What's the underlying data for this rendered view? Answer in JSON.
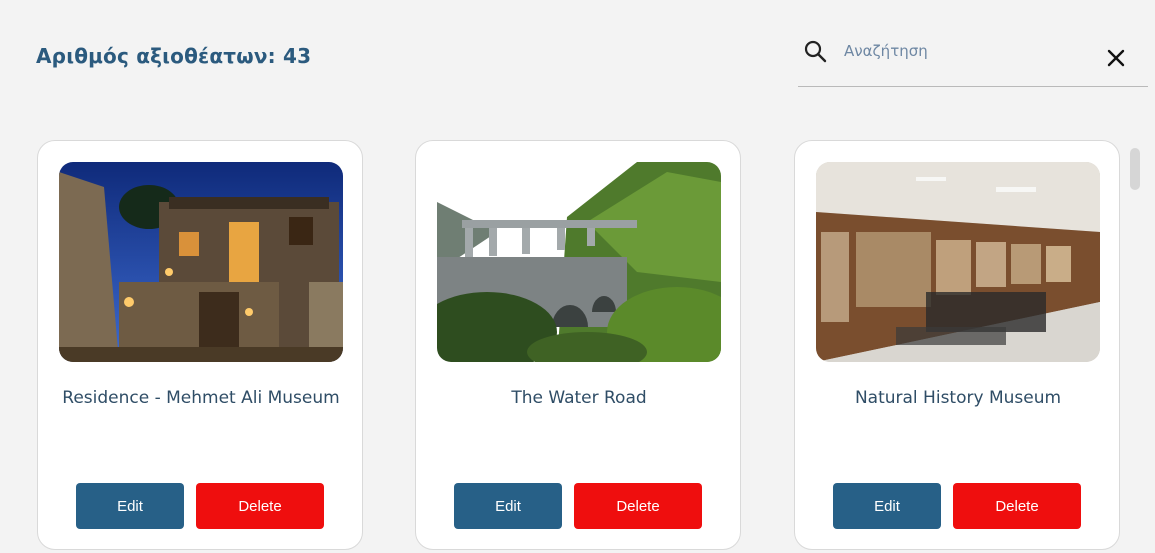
{
  "header": {
    "count_label": "Αριθμός αξιοθέατων: 43"
  },
  "search": {
    "placeholder": "Αναζήτηση",
    "value": "",
    "icon": "search-icon",
    "clear_icon": "close-icon"
  },
  "cards": [
    {
      "title": "Residence - Mehmet Ali Museum",
      "image": "residence-photo",
      "edit_label": "Edit",
      "delete_label": "Delete"
    },
    {
      "title": "The Water Road",
      "image": "aqueduct-bridge-photo",
      "edit_label": "Edit",
      "delete_label": "Delete"
    },
    {
      "title": "Natural History Museum",
      "image": "museum-gallery-photo",
      "edit_label": "Edit",
      "delete_label": "Delete"
    }
  ],
  "colors": {
    "title": "#2b5a7e",
    "edit_button": "#276087",
    "delete_button": "#ef0e0e",
    "background": "#f3f3f3"
  }
}
